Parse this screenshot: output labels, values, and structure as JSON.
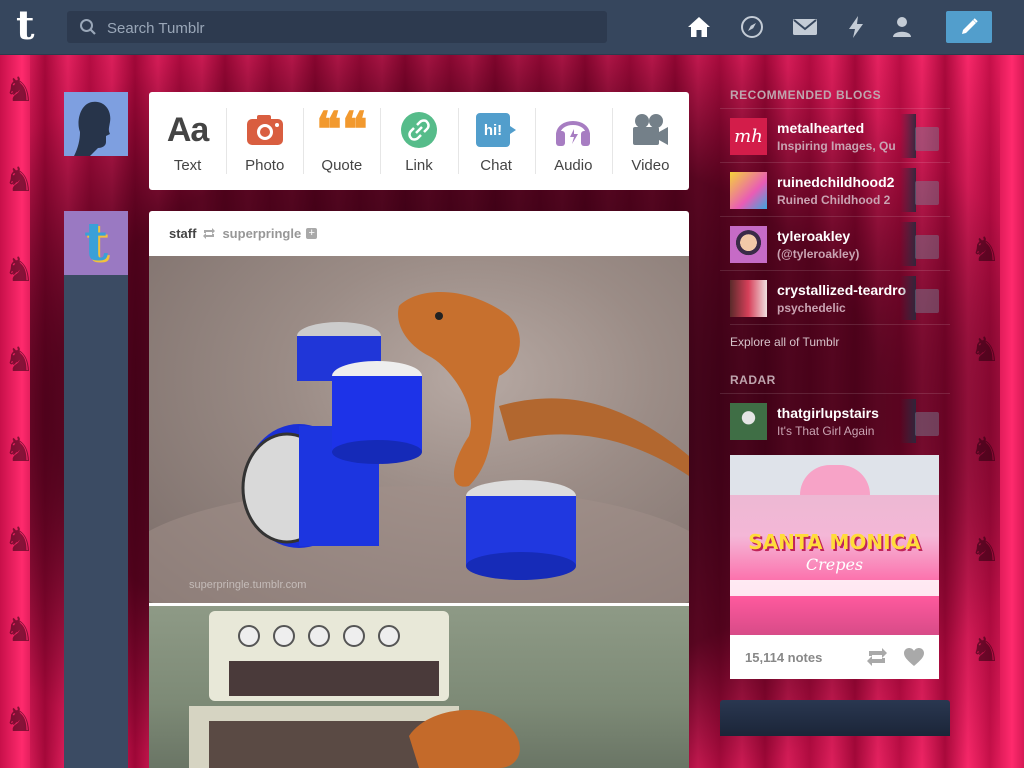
{
  "topbar": {
    "logo": "t",
    "search_placeholder": "Search Tumblr",
    "nav_icons": [
      "home-icon",
      "explore-compass-icon",
      "inbox-envelope-icon",
      "activity-lightning-icon",
      "account-person-icon"
    ],
    "compose_icon": "pencil-icon"
  },
  "composer": {
    "types": [
      {
        "label": "Text",
        "glyph": "Aa",
        "color": "#444444",
        "icon": "text-icon"
      },
      {
        "label": "Photo",
        "glyph": "camera",
        "color": "#d95e40",
        "icon": "camera-icon"
      },
      {
        "label": "Quote",
        "glyph": "❝❝",
        "color": "#f2992e",
        "icon": "quote-icon"
      },
      {
        "label": "Link",
        "glyph": "link",
        "color": "#56bc8a",
        "icon": "link-icon"
      },
      {
        "label": "Chat",
        "glyph": "hi!",
        "color": "#529ecc",
        "icon": "chat-icon"
      },
      {
        "label": "Audio",
        "glyph": "headphones",
        "color": "#a77dc2",
        "icon": "headphones-icon"
      },
      {
        "label": "Video",
        "glyph": "videocam",
        "color": "#748089",
        "icon": "video-camera-icon"
      }
    ]
  },
  "post": {
    "user": "staff",
    "reblogged_from": "superpringle",
    "watermark": "superpringle.tumblr.com"
  },
  "sidebar": {
    "recommended_title": "RECOMMENDED BLOGS",
    "blogs": [
      {
        "name": "metalhearted",
        "desc": "Inspiring Images, Qu",
        "thumb_color": "#d31d4a",
        "thumb_text": "mh"
      },
      {
        "name": "ruinedchildhood2",
        "desc": "Ruined Childhood 2",
        "thumb_color": "#e8c13c",
        "thumb_text": ""
      },
      {
        "name": "tyleroakley",
        "desc": "(@tyleroakley)",
        "thumb_color": "#9a6bb0",
        "thumb_text": ""
      },
      {
        "name": "crystallized-teardro",
        "desc": "psychedelic",
        "thumb_color": "#c23b4d",
        "thumb_text": ""
      }
    ],
    "explore": "Explore all of Tumblr",
    "radar_title": "RADAR",
    "radar": {
      "name": "thatgirlupstairs",
      "desc": "It's That Girl Again",
      "thumb_color": "#3f6e45",
      "image_sign": "SANTA MONICA",
      "image_sign2": "Crepes",
      "notes": "15,114 notes"
    }
  },
  "colors": {
    "topbar": "#36465d",
    "accent": "#529ecc",
    "background_pink": "#ff2a6d"
  }
}
